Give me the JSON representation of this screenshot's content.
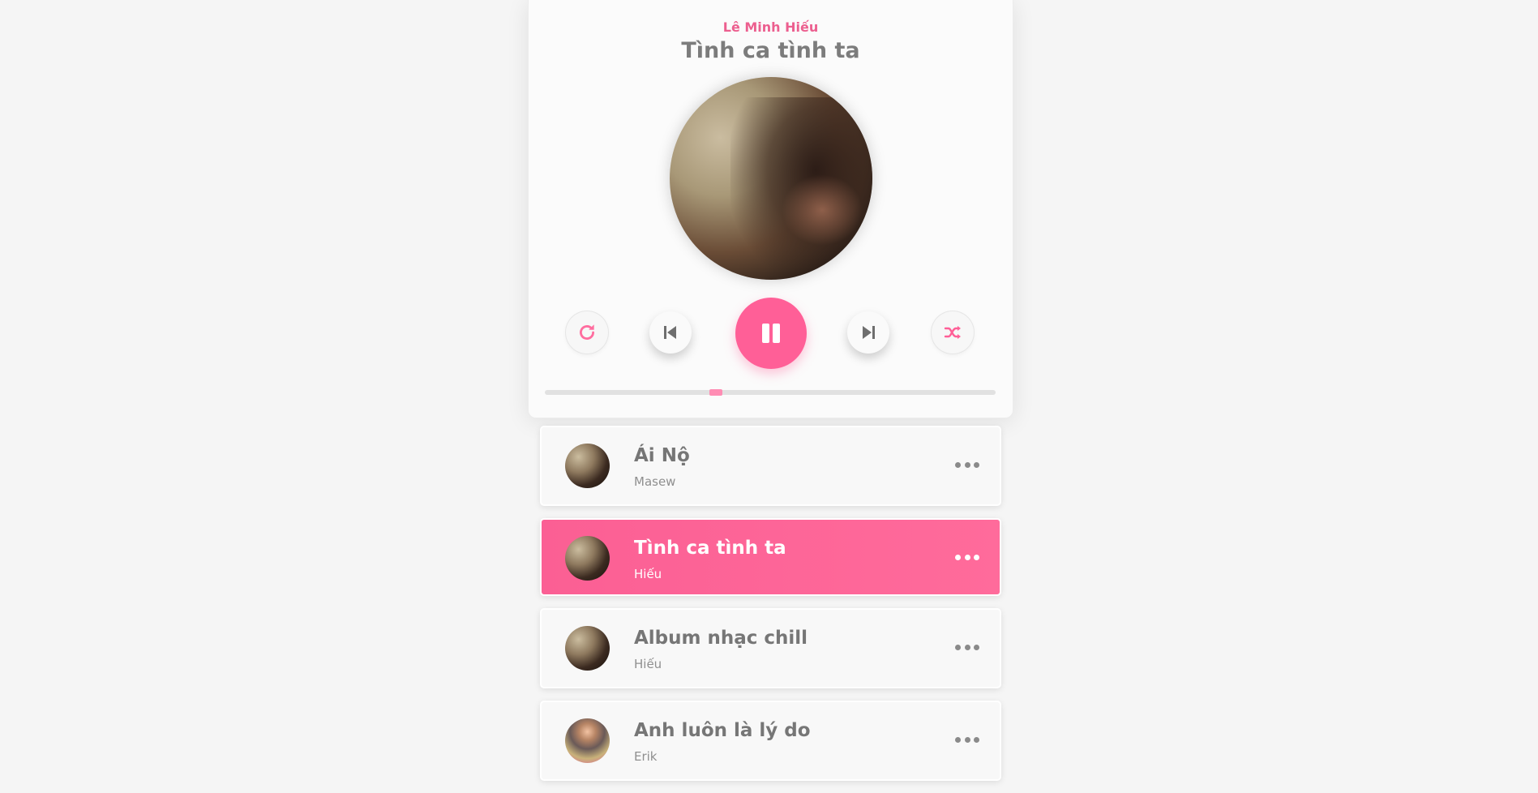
{
  "player": {
    "artist": "Lê Minh Hiếu",
    "title": "Tình ca tình ta",
    "progress_fraction": 0.38,
    "controls": {
      "repeat": "repeat-icon",
      "prev": "skip-back-icon",
      "play": "pause-icon",
      "next": "skip-forward-icon",
      "random": "shuffle-icon"
    }
  },
  "colors": {
    "accent": "#ff5f97",
    "text": "#767676"
  },
  "playlist": [
    {
      "name": "Ái Nộ",
      "artist": "Masew",
      "active": false,
      "more": "more-icon"
    },
    {
      "name": "Tình ca tình ta",
      "artist": "Hiếu",
      "active": true,
      "more": "more-icon"
    },
    {
      "name": "Album nhạc chill",
      "artist": "Hiếu",
      "active": false,
      "more": "more-icon"
    },
    {
      "name": "Anh luôn là lý do",
      "artist": "Erik",
      "active": false,
      "more": "more-icon"
    }
  ]
}
